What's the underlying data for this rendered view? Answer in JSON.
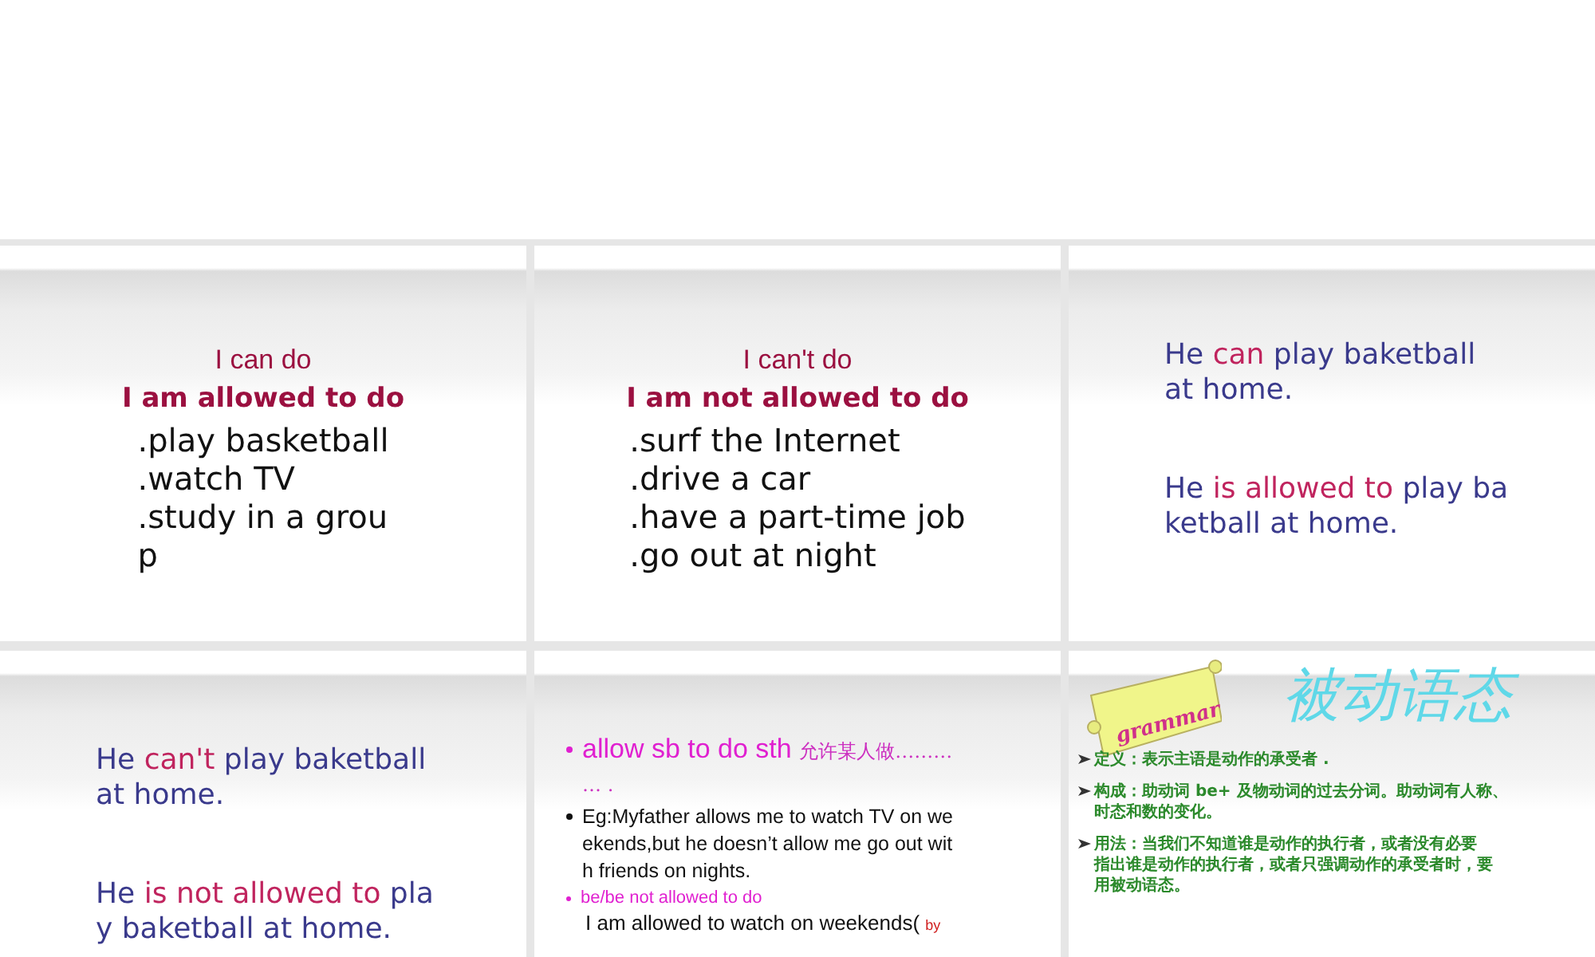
{
  "slides": [
    {
      "kind": "list",
      "heading": "I can do",
      "subheading": "I am allowed to do",
      "items": [
        ".play basketball",
        ".watch TV",
        ".study in a grou",
        "p"
      ]
    },
    {
      "kind": "list",
      "heading": "I can't do",
      "subheading": "I am not allowed to do",
      "items": [
        ".surf the Internet",
        ".drive a car",
        ".have a part-time job",
        ".go out at night"
      ]
    },
    {
      "kind": "sentences",
      "paragraphs": [
        {
          "lines": [
            [
              {
                "text": "He ",
                "highlight": false
              },
              {
                "text": "can",
                "highlight": true
              },
              {
                "text": " play baketball",
                "highlight": false
              }
            ],
            [
              {
                "text": "at home.",
                "highlight": false
              }
            ]
          ]
        },
        {
          "lines": [
            [
              {
                "text": "He ",
                "highlight": false
              },
              {
                "text": "is allowed to",
                "highlight": true
              },
              {
                "text": " play ba",
                "highlight": false
              }
            ],
            [
              {
                "text": "ketball at home.",
                "highlight": false
              }
            ]
          ]
        }
      ]
    },
    {
      "kind": "sentences",
      "paragraphs": [
        {
          "lines": [
            [
              {
                "text": "He ",
                "highlight": false
              },
              {
                "text": "can't",
                "highlight": true
              },
              {
                "text": " play baketball",
                "highlight": false
              }
            ],
            [
              {
                "text": "at home.",
                "highlight": false
              }
            ]
          ]
        },
        {
          "lines": [
            [
              {
                "text": "He ",
                "highlight": false
              },
              {
                "text": "is not allowed to",
                "highlight": true
              },
              {
                "text": " pla",
                "highlight": false
              }
            ],
            [
              {
                "text": "y baketball at home.",
                "highlight": false
              }
            ]
          ]
        }
      ]
    },
    {
      "kind": "bullets",
      "items": [
        {
          "kind": "key",
          "lines": [
            [
              {
                "text": "allow sb to do  sth  ",
                "small": false
              },
              {
                "text": "允许某人做………",
                "small": true
              }
            ],
            [
              {
                "text": "… .",
                "small": true
              }
            ]
          ]
        },
        {
          "kind": "example",
          "lines": [
            [
              {
                "text": "Eg:Myfather allows me to watch TV on we",
                "small": false
              }
            ],
            [
              {
                "text": "ekends,but he doesn’t allow  me go out wit",
                "small": false
              }
            ],
            [
              {
                "text": "h friends on nights.",
                "small": false
              }
            ]
          ]
        },
        {
          "kind": "subkey",
          "lines": [
            [
              {
                "text": "be/be not allowed to  do",
                "small": false
              }
            ]
          ]
        },
        {
          "kind": "plain",
          "lines": [
            [
              {
                "text": "I am allowed to watch on weekends( ",
                "small": false
              },
              {
                "text": "by",
                "small": true
              }
            ]
          ]
        }
      ]
    },
    {
      "kind": "grammar",
      "label": "grammar",
      "title": "被动语态",
      "notes": [
        {
          "lines": [
            "定义：表示主语是动作的承受者 ."
          ]
        },
        {
          "lines": [
            "构成：助动词 be+ 及物动词的过去分词。助动词有人称、",
            "时态和数的变化。"
          ]
        },
        {
          "lines": [
            "用法：当我们不知道谁是动作的执行者，或者没有必要",
            "指出谁是动作的执行者，或者只强调动作的承受者时，要",
            "用被动语态。"
          ]
        }
      ]
    }
  ]
}
